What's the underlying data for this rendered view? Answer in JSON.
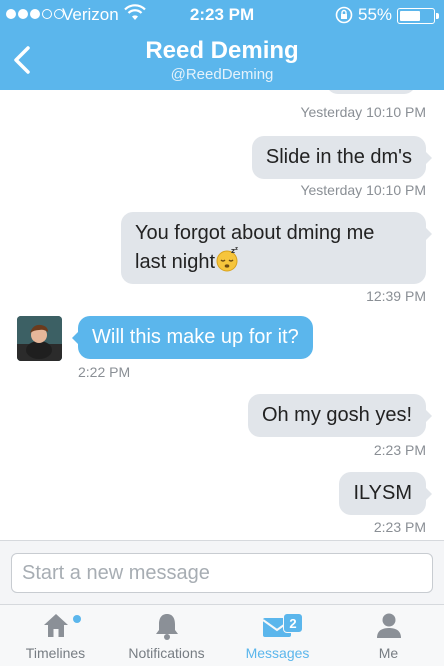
{
  "status_bar": {
    "carrier": "Verizon",
    "time": "2:23 PM",
    "battery": "55%"
  },
  "header": {
    "title": "Reed Deming",
    "handle": "@ReedDeming"
  },
  "messages": [
    {
      "direction": "out",
      "text": "",
      "timestamp": "Yesterday 10:10 PM"
    },
    {
      "direction": "out",
      "text": "Slide in the dm's",
      "timestamp": "Yesterday 10:10 PM"
    },
    {
      "direction": "out",
      "text_line1": "You forgot about dming me",
      "text_line2": "last night",
      "emoji": "sleeping-face-emoji",
      "timestamp": "12:39 PM"
    },
    {
      "direction": "in",
      "text": "Will this make up for it?",
      "timestamp": "2:22 PM"
    },
    {
      "direction": "out",
      "text": "Oh my gosh yes!",
      "timestamp": "2:23 PM"
    },
    {
      "direction": "out",
      "text": "ILYSM",
      "timestamp": "2:23 PM"
    }
  ],
  "composer": {
    "placeholder": "Start a new message"
  },
  "tabs": [
    {
      "label": "Timelines",
      "icon": "home-icon"
    },
    {
      "label": "Notifications",
      "icon": "bell-icon"
    },
    {
      "label": "Messages",
      "icon": "envelope-icon",
      "badge": "2",
      "active": true
    },
    {
      "label": "Me",
      "icon": "person-icon"
    }
  ],
  "colors": {
    "accent": "#5bb6ec",
    "outgoing_bubble": "#e1e5ea",
    "timestamp": "#8a8f95"
  }
}
